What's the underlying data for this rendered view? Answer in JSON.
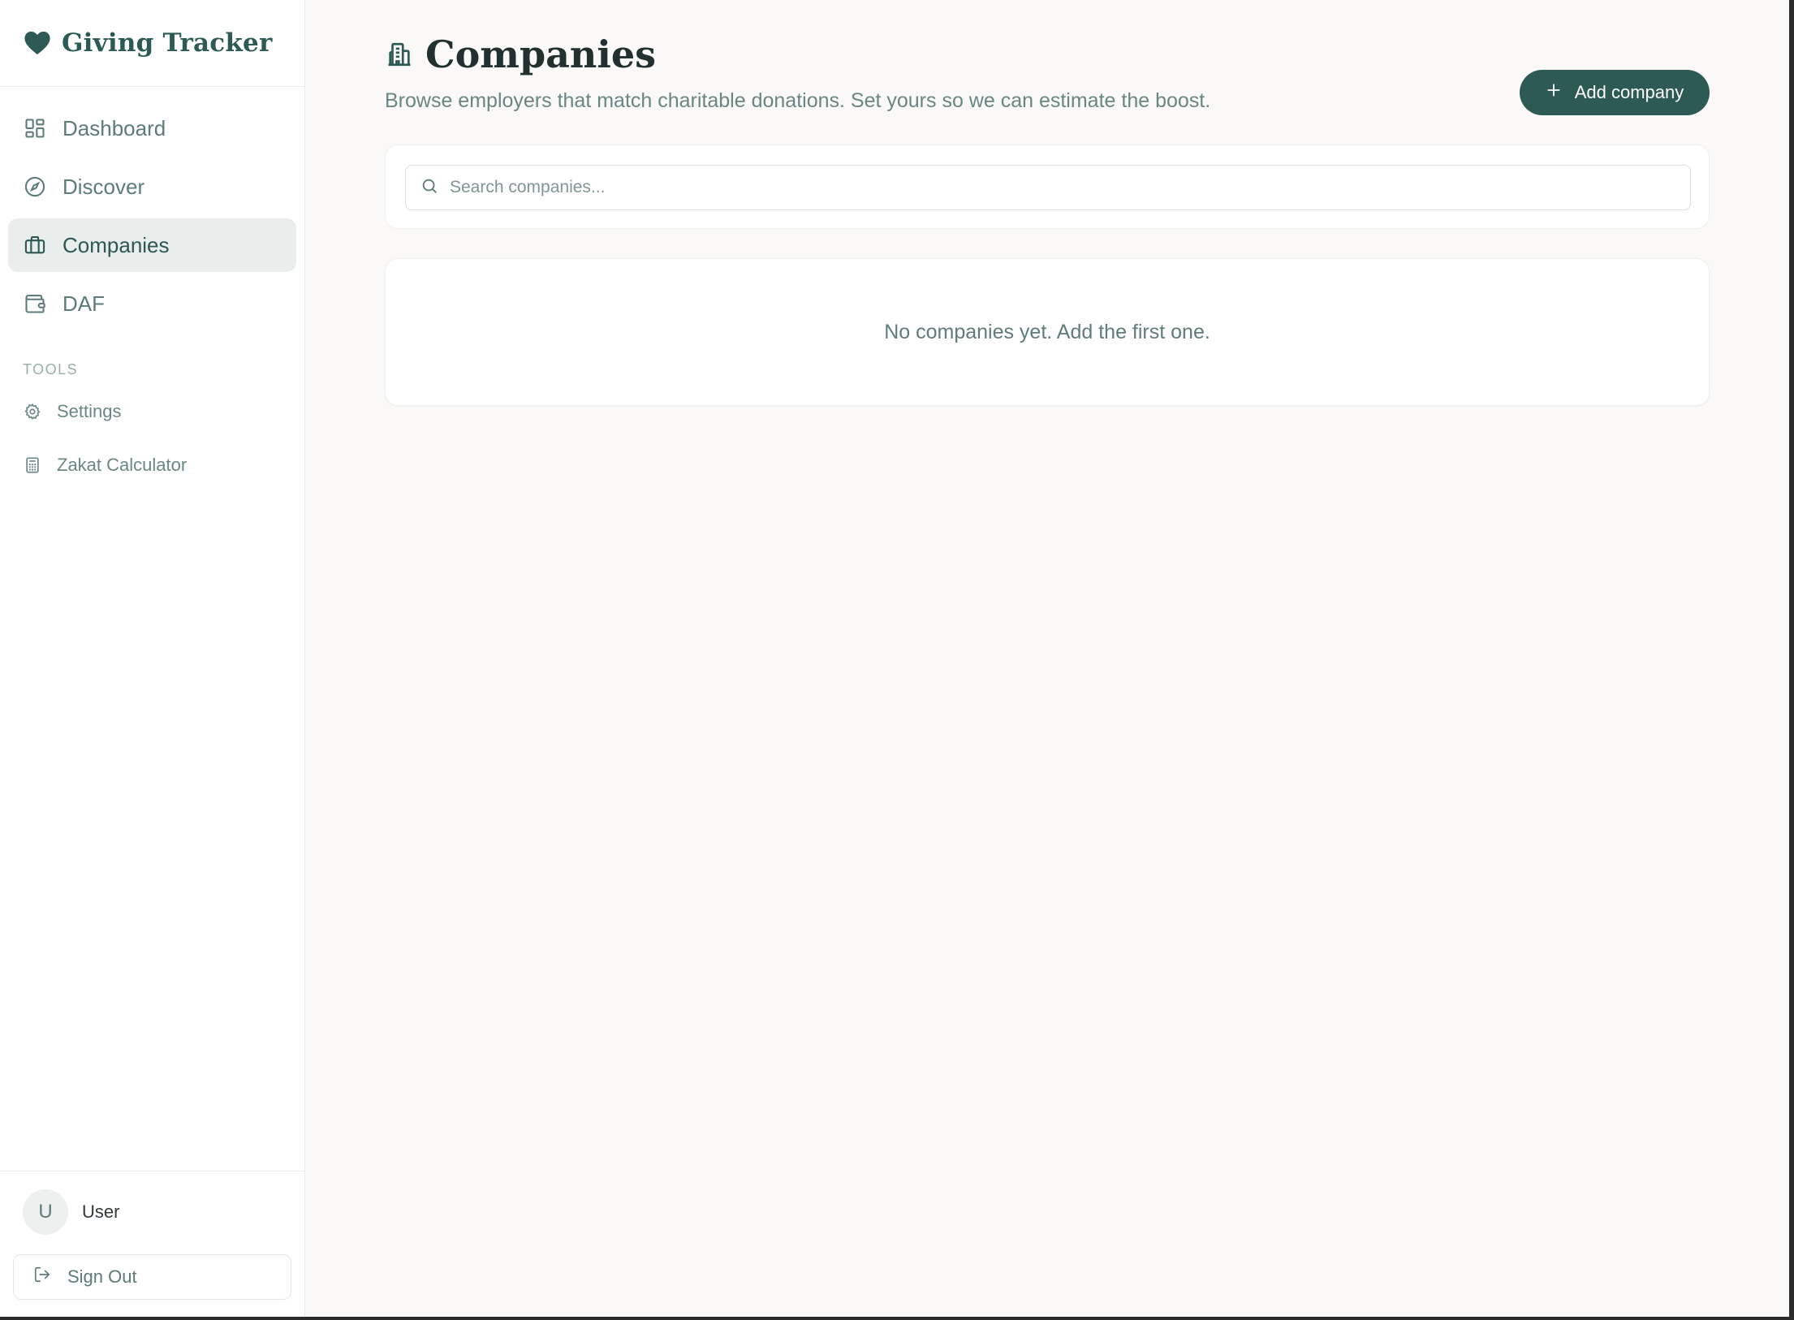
{
  "app": {
    "title": "Giving Tracker",
    "brand_icon": "heart-icon",
    "accent_color": "#2d5a55"
  },
  "sidebar": {
    "items": [
      {
        "label": "Dashboard",
        "icon": "dashboard-grid-icon",
        "active": false
      },
      {
        "label": "Discover",
        "icon": "compass-icon",
        "active": false
      },
      {
        "label": "Companies",
        "icon": "briefcase-icon",
        "active": true
      },
      {
        "label": "DAF",
        "icon": "wallet-icon",
        "active": false
      }
    ],
    "tools_label": "TOOLS",
    "tools": [
      {
        "label": "Settings",
        "icon": "gear-icon"
      },
      {
        "label": "Zakat Calculator",
        "icon": "calculator-icon"
      }
    ],
    "user": {
      "avatar_initial": "U",
      "name": "User"
    },
    "sign_out_label": "Sign Out"
  },
  "main": {
    "title": "Companies",
    "title_icon": "building-icon",
    "subtitle": "Browse employers that match charitable donations. Set yours so we can estimate the boost.",
    "add_button_label": "Add company",
    "search": {
      "placeholder": "Search companies...",
      "value": ""
    },
    "empty_message": "No companies yet. Add the first one."
  }
}
